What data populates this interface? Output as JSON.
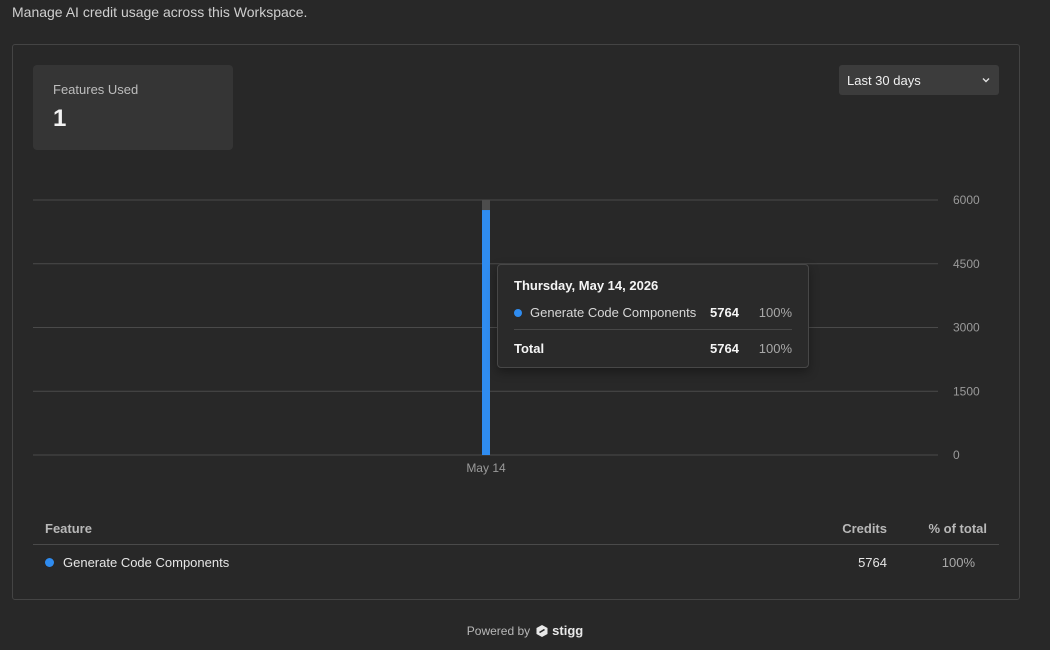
{
  "header": {
    "subtitle": "Manage AI credit usage across this Workspace."
  },
  "stat": {
    "label": "Features Used",
    "value": "1"
  },
  "range_select": {
    "selected": "Last 30 days"
  },
  "colors": {
    "accent": "#2f8cf0",
    "bar_cap": "#4d4d4d",
    "grid": "#4a4a4a"
  },
  "chart_data": {
    "type": "bar",
    "categories": [
      "May 14"
    ],
    "series": [
      {
        "name": "Generate Code Components",
        "values": [
          5764
        ]
      }
    ],
    "ylim": [
      0,
      6000
    ],
    "yticks": [
      "6000",
      "4500",
      "3000",
      "1500",
      "0"
    ],
    "ytick_values": [
      6000,
      4500,
      3000,
      1500,
      0
    ],
    "grid": true
  },
  "tooltip": {
    "date": "Thursday, May 14, 2026",
    "feature": "Generate Code Components",
    "value": "5764",
    "pct": "100%",
    "total_label": "Total",
    "total_value": "5764",
    "total_pct": "100%"
  },
  "table": {
    "headers": {
      "feature": "Feature",
      "credits": "Credits",
      "pct": "% of total"
    },
    "rows": [
      {
        "feature": "Generate Code Components",
        "credits": "5764",
        "pct": "100%"
      }
    ]
  },
  "footer": {
    "powered_by": "Powered by",
    "brand": "stigg",
    "brand_icon": "stigg-logo-icon"
  }
}
